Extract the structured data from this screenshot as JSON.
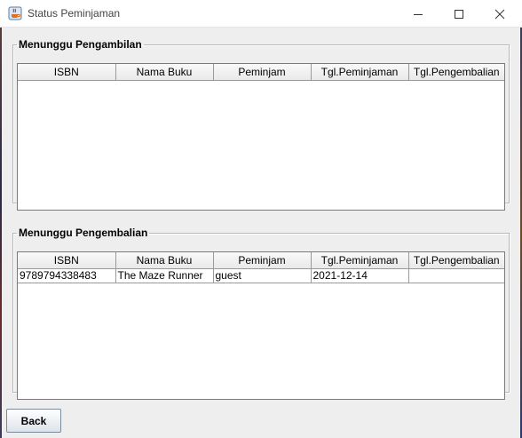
{
  "window": {
    "title": "Status Peminjaman",
    "icon": "java-cup-icon"
  },
  "columns": [
    "ISBN",
    "Nama Buku",
    "Peminjam",
    "Tgl.Peminjaman",
    "Tgl.Pengembalian"
  ],
  "pickup_panel": {
    "title": "Menunggu Pengambilan",
    "rows": []
  },
  "return_panel": {
    "title": "Menunggu Pengembalian",
    "rows": [
      {
        "isbn": "9789794338483",
        "nama_buku": "The Maze Runner",
        "peminjam": "guest",
        "tgl_peminjaman": "2021-12-14",
        "tgl_pengembalian": ""
      }
    ]
  },
  "back_button": {
    "label": "Back"
  }
}
